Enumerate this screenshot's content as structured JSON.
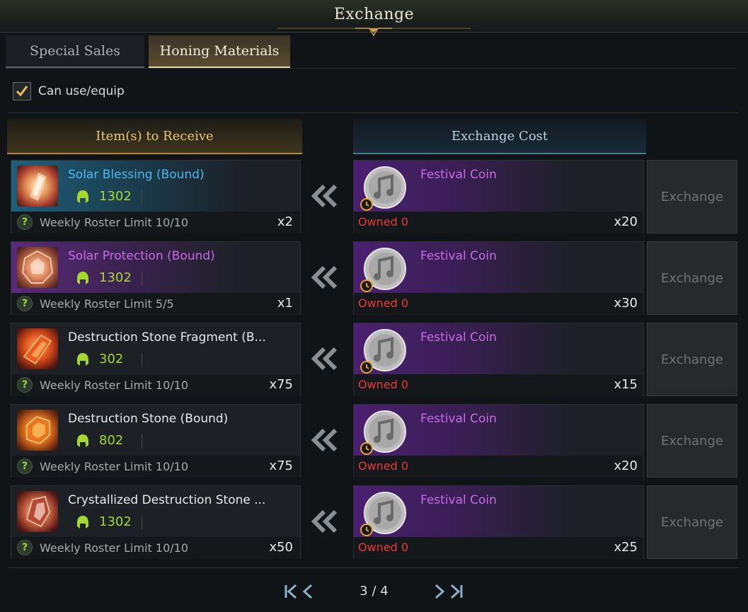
{
  "window": {
    "title": "Exchange"
  },
  "tabs": [
    {
      "label": "Special Sales",
      "active": false
    },
    {
      "label": "Honing Materials",
      "active": true
    }
  ],
  "filter": {
    "label": "Can use/equip",
    "checked": true
  },
  "headers": {
    "receive": "Item(s) to Receive",
    "cost": "Exchange Cost"
  },
  "rows": [
    {
      "name": "Solar Blessing (Bound)",
      "rarity": "blue",
      "item_level": "1302",
      "limit": "Weekly Roster Limit 10/10",
      "qty": "x2",
      "cost": {
        "currency": "Festival Coin",
        "owned": "Owned 0",
        "qty": "x20"
      },
      "button": "Exchange"
    },
    {
      "name": "Solar Protection (Bound)",
      "rarity": "purple",
      "item_level": "1302",
      "limit": "Weekly Roster Limit 5/5",
      "qty": "x1",
      "cost": {
        "currency": "Festival Coin",
        "owned": "Owned 0",
        "qty": "x30"
      },
      "button": "Exchange"
    },
    {
      "name": "Destruction Stone Fragment (B...",
      "rarity": "white",
      "item_level": "302",
      "limit": "Weekly Roster Limit 10/10",
      "qty": "x75",
      "cost": {
        "currency": "Festival Coin",
        "owned": "Owned 0",
        "qty": "x15"
      },
      "button": "Exchange"
    },
    {
      "name": "Destruction Stone (Bound)",
      "rarity": "white",
      "item_level": "802",
      "limit": "Weekly Roster Limit 10/10",
      "qty": "x75",
      "cost": {
        "currency": "Festival Coin",
        "owned": "Owned 0",
        "qty": "x20"
      },
      "button": "Exchange"
    },
    {
      "name": "Crystallized Destruction Stone ...",
      "rarity": "white",
      "item_level": "1302",
      "limit": "Weekly Roster Limit 10/10",
      "qty": "x50",
      "cost": {
        "currency": "Festival Coin",
        "owned": "Owned 0",
        "qty": "x25"
      },
      "button": "Exchange"
    }
  ],
  "pagination": {
    "text": "3 / 4"
  },
  "icons": {
    "checkbox": "checkmark-icon",
    "item_level": "helmet-icon",
    "help": "question-mark-icon",
    "transfer": "double-chevron-left-icon",
    "currency": "festival-coin-icon",
    "timer": "stopwatch-icon",
    "first": "first-page-icon",
    "prev": "previous-page-icon",
    "next": "next-page-icon",
    "last": "last-page-icon"
  },
  "colors": {
    "accent_gold": "#e8c874",
    "accent_blue": "#b9d2e2",
    "rarity_blue": "#4ab8ee",
    "rarity_purple": "#c86ae6",
    "item_level": "#a4d830",
    "owned_insufficient": "#e83b34"
  }
}
